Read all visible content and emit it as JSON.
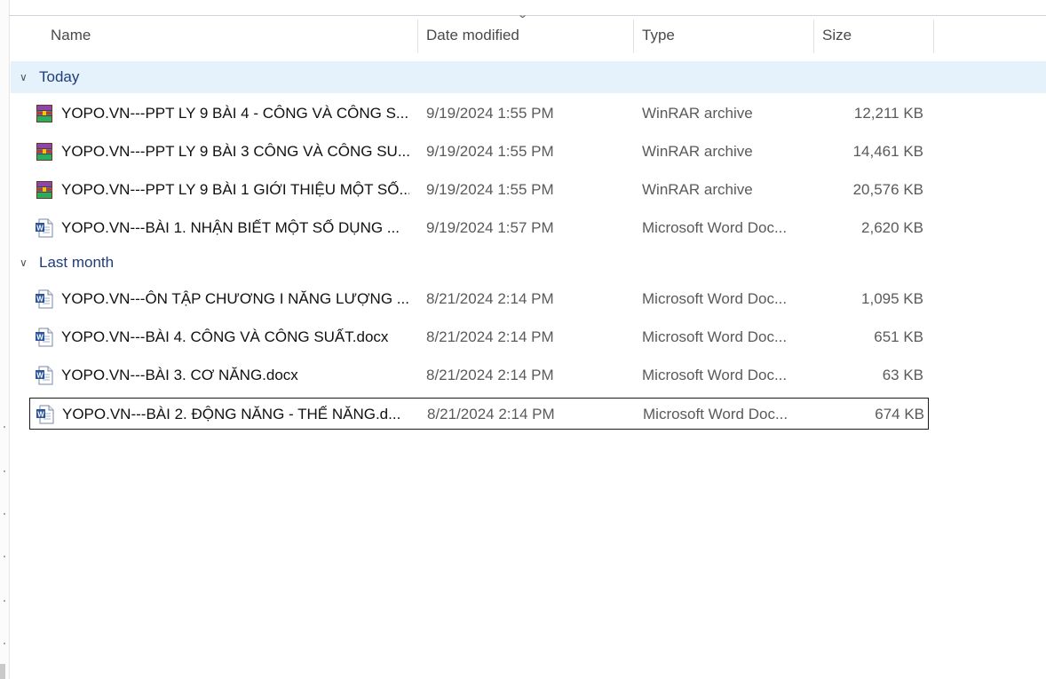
{
  "columns": {
    "name": "Name",
    "date_modified": "Date modified",
    "type": "Type",
    "size": "Size"
  },
  "groups": [
    {
      "label": "Today",
      "files": [
        {
          "name": "YOPO.VN---PPT LY 9 BÀI 4 - CÔNG VÀ CÔNG S...",
          "date": "9/19/2024 1:55 PM",
          "type": "WinRAR archive",
          "size": "12,211 KB",
          "icon": "winrar-archive-icon"
        },
        {
          "name": "YOPO.VN---PPT LY 9 BÀI 3  CÔNG VÀ CÔNG SU...",
          "date": "9/19/2024 1:55 PM",
          "type": "WinRAR archive",
          "size": "14,461 KB",
          "icon": "winrar-archive-icon"
        },
        {
          "name": "YOPO.VN---PPT LY 9 BÀI 1 GIỚI THIỆU MỘT SỐ...",
          "date": "9/19/2024 1:55 PM",
          "type": "WinRAR archive",
          "size": "20,576 KB",
          "icon": "winrar-archive-icon"
        },
        {
          "name": "YOPO.VN---BÀI 1. NHẬN BIẾT MỘT SỐ DỤNG ...",
          "date": "9/19/2024 1:57 PM",
          "type": "Microsoft Word Doc...",
          "size": "2,620 KB",
          "icon": "word-document-icon"
        }
      ]
    },
    {
      "label": "Last month",
      "files": [
        {
          "name": "YOPO.VN---ÔN TẬP CHƯƠNG I NĂNG LƯỢNG ...",
          "date": "8/21/2024 2:14 PM",
          "type": "Microsoft Word Doc...",
          "size": "1,095 KB",
          "icon": "word-document-icon"
        },
        {
          "name": "YOPO.VN---BÀI 4. CÔNG VÀ CÔNG SUẤT.docx",
          "date": "8/21/2024 2:14 PM",
          "type": "Microsoft Word Doc...",
          "size": "651 KB",
          "icon": "word-document-icon"
        },
        {
          "name": "YOPO.VN---BÀI 3. CƠ NĂNG.docx",
          "date": "8/21/2024 2:14 PM",
          "type": "Microsoft Word Doc...",
          "size": "63 KB",
          "icon": "word-document-icon"
        },
        {
          "name": "YOPO.VN---BÀI 2. ĐỘNG NĂNG - THẾ NĂNG.d...",
          "date": "8/21/2024 2:14 PM",
          "type": "Microsoft Word Doc...",
          "size": "674 KB",
          "icon": "word-document-icon",
          "selected": true
        }
      ]
    }
  ],
  "colors": {
    "group_header_text": "#1f3d7a",
    "group_header_bg": "#e5f1fb",
    "selection_border": "#1b1b1b",
    "word_icon_blue": "#2b579a",
    "winrar_red": "#c0392b"
  }
}
